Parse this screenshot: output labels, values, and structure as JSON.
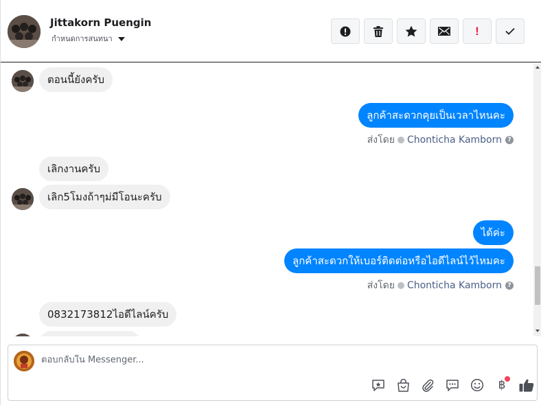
{
  "header": {
    "contact_name": "Jittakorn Puengin",
    "assign_label": "กำหนดการสนทนา",
    "actions": [
      {
        "name": "spam-button",
        "icon": "alert-circle-icon"
      },
      {
        "name": "delete-button",
        "icon": "trash-icon"
      },
      {
        "name": "star-button",
        "icon": "star-icon"
      },
      {
        "name": "mark-unread-button",
        "icon": "envelope-icon"
      },
      {
        "name": "follow-up-button",
        "icon": "exclamation-icon",
        "label": "!"
      },
      {
        "name": "mark-done-button",
        "icon": "checkmark-icon"
      }
    ]
  },
  "messages": [
    {
      "side": "in",
      "text": "ตอนนี้ยังครับ"
    },
    {
      "side": "out",
      "text": "ลูกค้าสะดวกคุยเป็นเวลาไหนคะ"
    },
    {
      "side": "in",
      "text": "เลิกงานครับ"
    },
    {
      "side": "in",
      "text": "เลิก5โมงถ้าๆม่มีโอนะครับ"
    },
    {
      "side": "out",
      "text": "ได้ค่ะ"
    },
    {
      "side": "out",
      "text": "ลูกค้าสะดวกให้เบอร์ติดต่อหรือไอดีไลน์ไว้ไหมคะ"
    },
    {
      "side": "in",
      "text": "0832173812ไอดีไลน์ครับ"
    }
  ],
  "sent_by": {
    "prefix": "ส่งโดย",
    "agent": "Chonticha Kamborn",
    "help": "?"
  },
  "composer": {
    "placeholder": "ตอบกลับใน Messenger...",
    "tools": [
      "saved-reply-icon",
      "shop-bag-icon",
      "paperclip-icon",
      "chat-bubble-icon",
      "smiley-icon",
      "baht-icon",
      "thumbs-up-icon"
    ],
    "baht_symbol": "฿"
  },
  "colors": {
    "outgoing_bubble": "#0084ff",
    "incoming_bubble": "#f1f0f0",
    "follow_up_red": "#e41e3f",
    "agent_link": "#4a5e86"
  }
}
